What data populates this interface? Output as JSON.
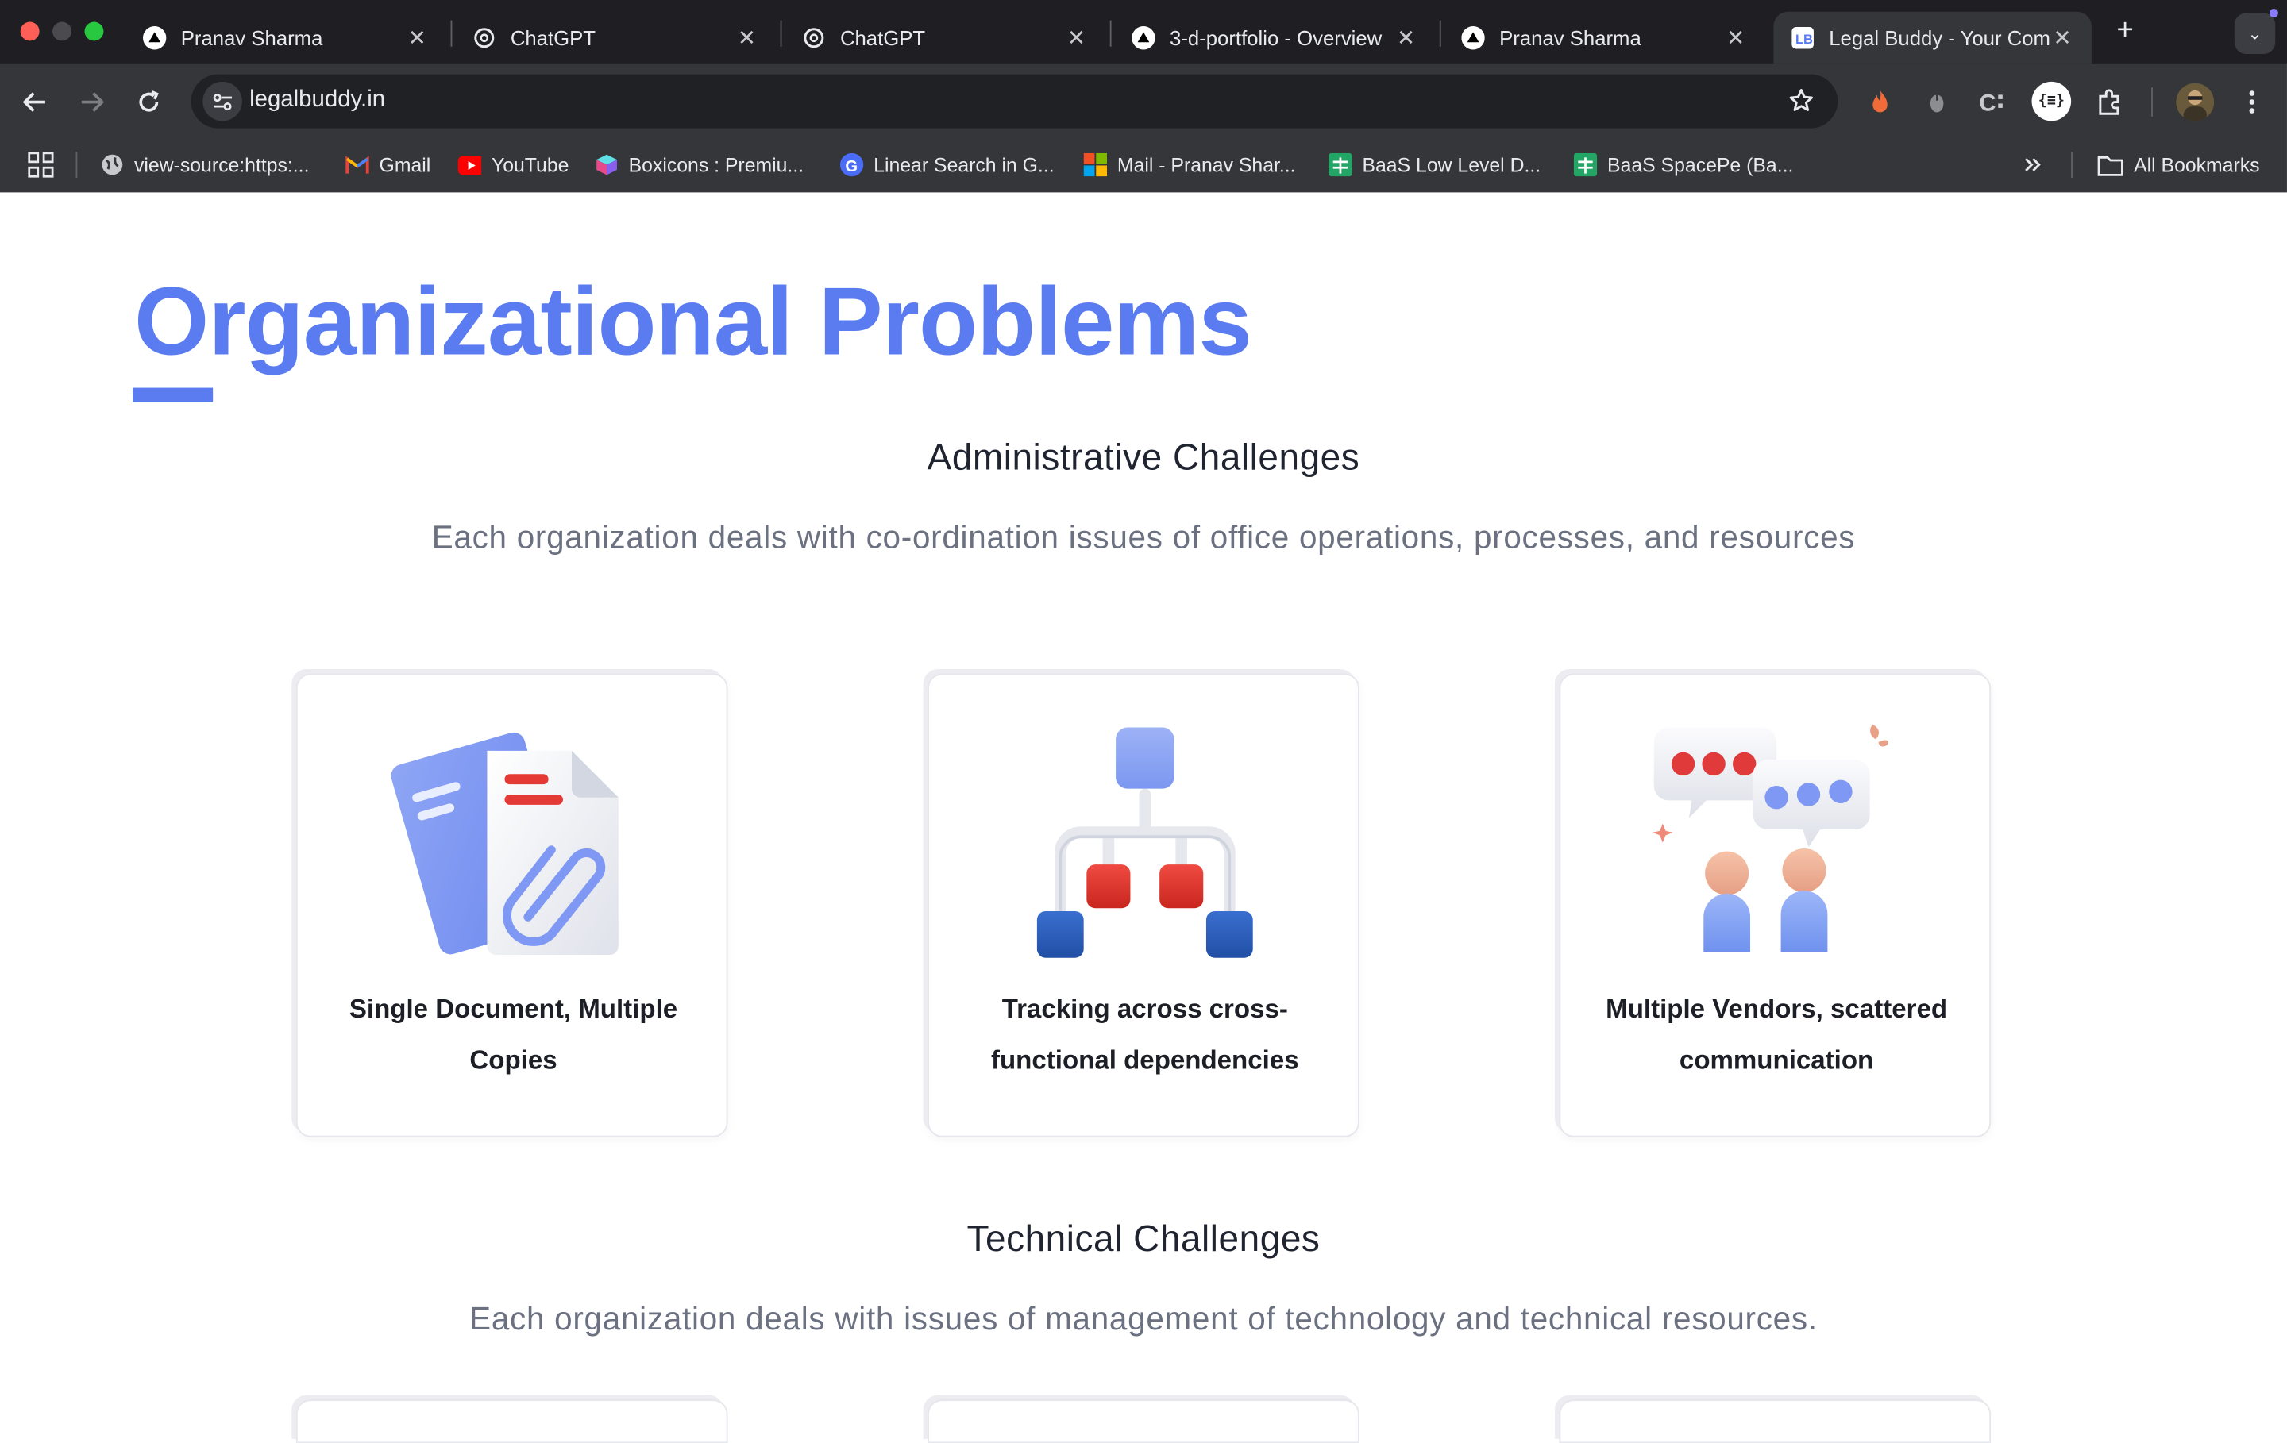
{
  "browser": {
    "tabs": [
      {
        "title": "Pranav Sharma",
        "favicon": "vercel-triangle-icon"
      },
      {
        "title": "ChatGPT",
        "favicon": "chatgpt-icon"
      },
      {
        "title": "ChatGPT",
        "favicon": "chatgpt-icon"
      },
      {
        "title": "3-d-portfolio - Overview",
        "favicon": "vercel-triangle-icon"
      },
      {
        "title": "Pranav Sharma",
        "favicon": "vercel-triangle-icon"
      },
      {
        "title": "Legal Buddy - Your Com",
        "favicon": "legalbuddy-icon",
        "active": true
      }
    ],
    "url": "legalbuddy.in",
    "bookmarks": [
      {
        "label": "view-source:https:...",
        "icon": "globe-icon"
      },
      {
        "label": "Gmail",
        "icon": "gmail-icon"
      },
      {
        "label": "YouTube",
        "icon": "youtube-icon"
      },
      {
        "label": "Boxicons : Premiu...",
        "icon": "boxicons-icon"
      },
      {
        "label": "Linear Search in G...",
        "icon": "geeks-icon"
      },
      {
        "label": "Mail - Pranav Shar...",
        "icon": "microsoft-icon"
      },
      {
        "label": "BaaS Low Level D...",
        "icon": "sheets-icon"
      },
      {
        "label": "BaaS SpacePe (Ba...",
        "icon": "sheets-icon"
      }
    ],
    "all_bookmarks_label": "All Bookmarks",
    "extension_badge": "{≡}"
  },
  "page": {
    "title": "Organizational Problems",
    "sections": [
      {
        "heading": "Administrative Challenges",
        "subtitle": "Each organization deals with co-ordination issues of office operations, processes, and resources",
        "cards": [
          {
            "label": "Single Document, Multiple Copies",
            "illustration": "documents-paperclip-illustration"
          },
          {
            "label": "Tracking across cross-functional dependencies",
            "illustration": "hierarchy-tree-illustration"
          },
          {
            "label": "Multiple Vendors, scattered communication",
            "illustration": "chat-people-illustration"
          }
        ]
      },
      {
        "heading": "Technical Challenges",
        "subtitle": "Each organization deals with issues of management of technology and technical resources."
      }
    ]
  },
  "colors": {
    "accent": "#5b7cf0",
    "illustration_blue": "#7e98f3",
    "illustration_red": "#e03a3a",
    "chrome_bg": "#35363a",
    "tabstrip_bg": "#1f1f23"
  }
}
